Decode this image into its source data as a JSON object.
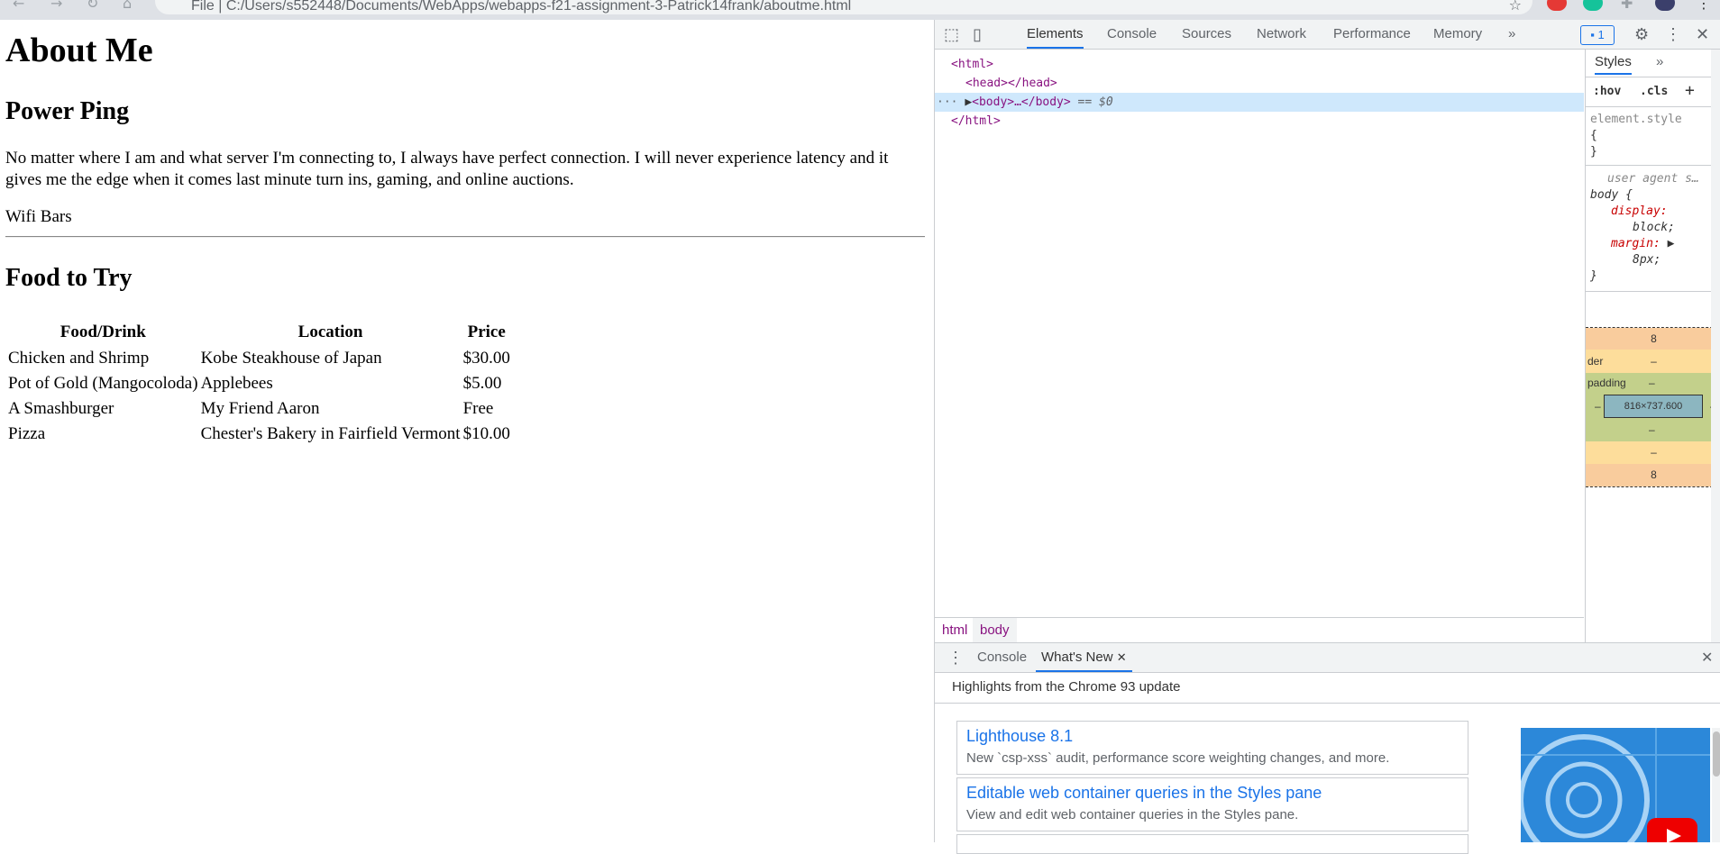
{
  "browser": {
    "url": "File  |  C:/Users/s552448/Documents/WebApps/webapps-f21-assignment-3-Patrick14frank/aboutme.html"
  },
  "page": {
    "h1": "About Me",
    "section1_title": "Power Ping",
    "paragraph": "No matter where I am and what server I'm connecting to, I always have perfect connection. I will never experience latency and it gives me the edge when it comes last minute turn ins, gaming, and online auctions.",
    "image_alt": "Wifi Bars",
    "section2_title": "Food to Try",
    "table": {
      "headers": [
        "Food/Drink",
        "Location",
        "Price"
      ],
      "rows": [
        [
          "Chicken and Shrimp",
          "Kobe Steakhouse of Japan",
          "$30.00"
        ],
        [
          "Pot of Gold (Mangocoloda)",
          "Applebees",
          "$5.00"
        ],
        [
          "A Smashburger",
          "My Friend Aaron",
          "Free"
        ],
        [
          "Pizza",
          "Chester's Bakery in Fairfield Vermont",
          "$10.00"
        ]
      ]
    }
  },
  "devtools": {
    "tabs": [
      "Elements",
      "Console",
      "Sources",
      "Network",
      "Performance",
      "Memory"
    ],
    "more": "»",
    "issues_count": "1",
    "dom": {
      "html_open": "<html>",
      "head": "<head></head>",
      "body": "<body>…</body>",
      "body_hint": "== $0",
      "html_close": "</html>"
    },
    "breadcrumbs": [
      "html",
      "body"
    ],
    "styles": {
      "tab": "Styles",
      "hov": ":hov",
      "cls": ".cls",
      "plus": "+",
      "element_style": "element.style",
      "brace_open": "{",
      "brace_close": "}",
      "ua_comment": "user agent s…",
      "body_selector": "body {",
      "prop1": "display",
      "val1": "block;",
      "prop2": "margin",
      "val2": "8px;"
    },
    "box_model": {
      "margin_top": "8",
      "border_label": "der",
      "border_val": "–",
      "padding_label": "padding",
      "padding_val": "–",
      "content": "816×737.600",
      "side": "–",
      "padding_bottom": "–",
      "border_bottom": "–",
      "margin_bottom": "8"
    },
    "drawer": {
      "tabs": [
        "Console",
        "What's New"
      ],
      "subtitle": "Highlights from the Chrome 93 update",
      "cards": [
        {
          "title": "Lighthouse 8.1",
          "desc": "New `csp-xss` audit, performance score weighting changes, and more."
        },
        {
          "title": "Editable web container queries in the Styles pane",
          "desc": "View and edit web container queries in the Styles pane."
        }
      ]
    }
  },
  "colors": {
    "accent": "#1a73e8",
    "tag": "#881280",
    "selection": "#cfe8fc",
    "margin_box": "#f9cc9d",
    "padding_box": "#c3d08b",
    "content_box": "#8cb6c0"
  }
}
